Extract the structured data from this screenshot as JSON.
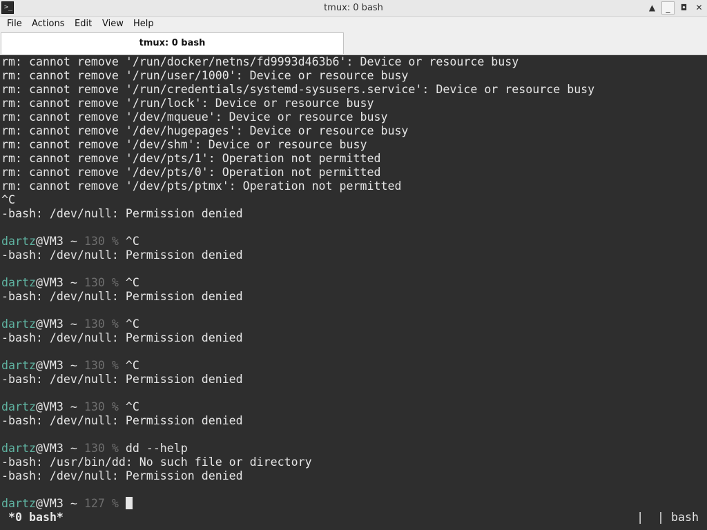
{
  "window": {
    "title": "tmux: 0 bash",
    "icon": "terminal-icon",
    "controls": {
      "shade": "▲",
      "minimize": "_",
      "maximize": "◘",
      "close": "✕"
    }
  },
  "menu": [
    {
      "label": "File"
    },
    {
      "label": "Actions"
    },
    {
      "label": "Edit"
    },
    {
      "label": "View"
    },
    {
      "label": "Help"
    }
  ],
  "tab": {
    "label": "tmux: 0 bash"
  },
  "prompt": {
    "user": "dartz",
    "host_suffix": "@VM3 ~ ",
    "suffix": " % "
  },
  "terminal_lines": [
    {
      "type": "text",
      "text": "rm: cannot remove '/run/docker/netns/fd9993d463b6': Device or resource busy"
    },
    {
      "type": "text",
      "text": "rm: cannot remove '/run/user/1000': Device or resource busy"
    },
    {
      "type": "text",
      "text": "rm: cannot remove '/run/credentials/systemd-sysusers.service': Device or resource busy"
    },
    {
      "type": "text",
      "text": "rm: cannot remove '/run/lock': Device or resource busy"
    },
    {
      "type": "text",
      "text": "rm: cannot remove '/dev/mqueue': Device or resource busy"
    },
    {
      "type": "text",
      "text": "rm: cannot remove '/dev/hugepages': Device or resource busy"
    },
    {
      "type": "text",
      "text": "rm: cannot remove '/dev/shm': Device or resource busy"
    },
    {
      "type": "text",
      "text": "rm: cannot remove '/dev/pts/1': Operation not permitted"
    },
    {
      "type": "text",
      "text": "rm: cannot remove '/dev/pts/0': Operation not permitted"
    },
    {
      "type": "text",
      "text": "rm: cannot remove '/dev/pts/ptmx': Operation not permitted"
    },
    {
      "type": "text",
      "text": "^C"
    },
    {
      "type": "text",
      "text": "-bash: /dev/null: Permission denied"
    },
    {
      "type": "text",
      "text": ""
    },
    {
      "type": "prompt",
      "code": "130",
      "command": "^C"
    },
    {
      "type": "text",
      "text": "-bash: /dev/null: Permission denied"
    },
    {
      "type": "text",
      "text": ""
    },
    {
      "type": "prompt",
      "code": "130",
      "command": "^C"
    },
    {
      "type": "text",
      "text": "-bash: /dev/null: Permission denied"
    },
    {
      "type": "text",
      "text": ""
    },
    {
      "type": "prompt",
      "code": "130",
      "command": "^C"
    },
    {
      "type": "text",
      "text": "-bash: /dev/null: Permission denied"
    },
    {
      "type": "text",
      "text": ""
    },
    {
      "type": "prompt",
      "code": "130",
      "command": "^C"
    },
    {
      "type": "text",
      "text": "-bash: /dev/null: Permission denied"
    },
    {
      "type": "text",
      "text": ""
    },
    {
      "type": "prompt",
      "code": "130",
      "command": "^C"
    },
    {
      "type": "text",
      "text": "-bash: /dev/null: Permission denied"
    },
    {
      "type": "text",
      "text": ""
    },
    {
      "type": "prompt",
      "code": "130",
      "command": "dd --help"
    },
    {
      "type": "text",
      "text": "-bash: /usr/bin/dd: No such file or directory"
    },
    {
      "type": "text",
      "text": "-bash: /dev/null: Permission denied"
    },
    {
      "type": "text",
      "text": ""
    },
    {
      "type": "prompt",
      "code": "127",
      "command": "",
      "cursor": true
    }
  ],
  "status": {
    "window_label": "*0 bash*",
    "right": "|  | bash"
  },
  "colors": {
    "terminal_bg": "#2e2e2e",
    "terminal_fg": "#e6e6e6",
    "prompt_user": "#5fb3a1",
    "prompt_muted": "#6e6e6e"
  }
}
